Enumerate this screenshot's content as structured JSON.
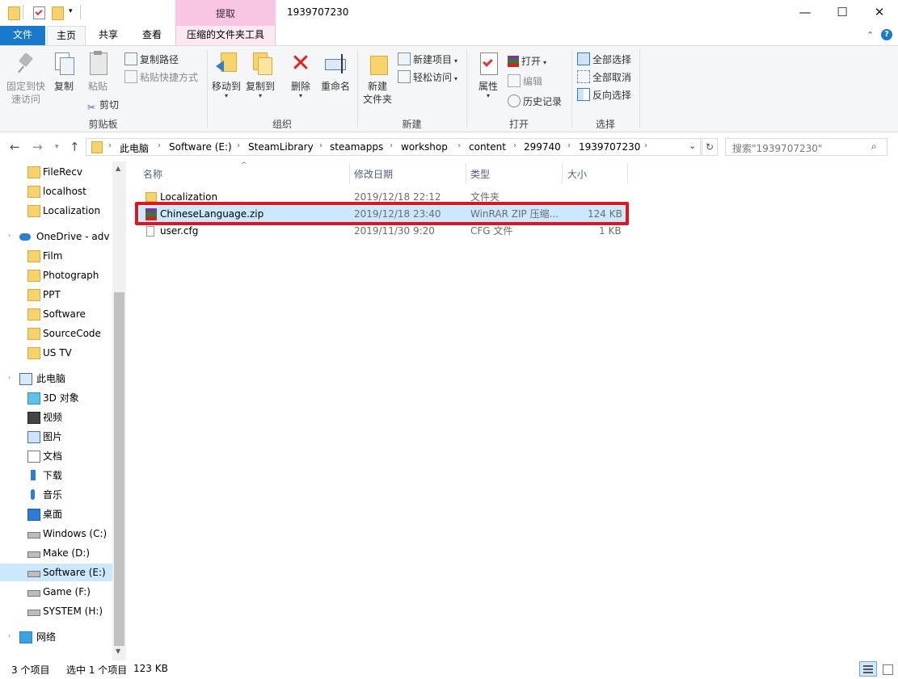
{
  "window": {
    "title": "1939707230",
    "context_tab": "提取",
    "minimize": "—",
    "maximize": "☐",
    "close": "✕"
  },
  "tabs": {
    "file": "文件",
    "home": "主页",
    "share": "共享",
    "view": "查看",
    "tools": "压缩的文件夹工具"
  },
  "ribbon": {
    "clipboard": {
      "label": "剪贴板",
      "pin": [
        "固定到快",
        "速访问"
      ],
      "copy": "复制",
      "paste": "粘贴",
      "copy_path": "复制路径",
      "paste_shortcut": "粘贴快捷方式",
      "cut": "剪切"
    },
    "organize": {
      "label": "组织",
      "move_to": "移动到",
      "copy_to": "复制到",
      "delete": "删除",
      "rename": "重命名"
    },
    "new": {
      "label": "新建",
      "new_folder": [
        "新建",
        "文件夹"
      ],
      "new_item": "新建项目",
      "easy_access": "轻松访问"
    },
    "open": {
      "label": "打开",
      "properties": "属性",
      "open": "打开",
      "edit": "编辑",
      "history": "历史记录"
    },
    "select": {
      "label": "选择",
      "select_all": "全部选择",
      "select_none": "全部取消",
      "invert": "反向选择"
    }
  },
  "address": {
    "crumbs": [
      "此电脑",
      "Software (E:)",
      "SteamLibrary",
      "steamapps",
      "workshop",
      "content",
      "299740",
      "1939707230"
    ],
    "search_placeholder": "搜索\"1939707230\""
  },
  "sidebar": {
    "items": [
      {
        "label": "FileRecv",
        "icon": "folder-icon"
      },
      {
        "label": "localhost",
        "icon": "folder-icon"
      },
      {
        "label": "Localization",
        "icon": "folder-icon"
      },
      {
        "label": "OneDrive - adv",
        "icon": "cloud-icon"
      },
      {
        "label": "Film",
        "icon": "folder-icon"
      },
      {
        "label": "Photograph",
        "icon": "folder-icon"
      },
      {
        "label": "PPT",
        "icon": "folder-icon"
      },
      {
        "label": "Software",
        "icon": "folder-icon"
      },
      {
        "label": "SourceCode",
        "icon": "folder-icon"
      },
      {
        "label": "US  TV",
        "icon": "folder-icon"
      },
      {
        "label": "此电脑",
        "icon": "computer-icon"
      },
      {
        "label": "3D 对象",
        "icon": "cube-icon"
      },
      {
        "label": "视频",
        "icon": "video-icon"
      },
      {
        "label": "图片",
        "icon": "picture-icon"
      },
      {
        "label": "文档",
        "icon": "document-icon"
      },
      {
        "label": "下载",
        "icon": "download-icon"
      },
      {
        "label": "音乐",
        "icon": "music-icon"
      },
      {
        "label": "桌面",
        "icon": "desktop-icon"
      },
      {
        "label": "Windows (C:)",
        "icon": "drive-icon"
      },
      {
        "label": "Make (D:)",
        "icon": "drive-icon"
      },
      {
        "label": "Software (E:)",
        "icon": "drive-icon"
      },
      {
        "label": "Game (F:)",
        "icon": "drive-icon"
      },
      {
        "label": "SYSTEM (H:)",
        "icon": "drive-icon"
      },
      {
        "label": "网络",
        "icon": "network-icon"
      }
    ]
  },
  "columns": {
    "name": "名称",
    "modified": "修改日期",
    "type": "类型",
    "size": "大小"
  },
  "files": [
    {
      "name": "Localization",
      "modified": "2019/12/18 22:12",
      "type": "文件夹",
      "size": ""
    },
    {
      "name": "ChineseLanguage.zip",
      "modified": "2019/12/18 23:40",
      "type": "WinRAR ZIP 压缩...",
      "size": "124 KB"
    },
    {
      "name": "user.cfg",
      "modified": "2019/11/30 9:20",
      "type": "CFG 文件",
      "size": "1 KB"
    }
  ],
  "status": {
    "count": "3 个项目",
    "selected": "选中 1 个项目",
    "size": "123 KB"
  },
  "colors": {
    "accent": "#1979ca",
    "selection": "#cce8ff",
    "highlight_box": "#e1141f",
    "context_tab": "#f8c6e2"
  }
}
